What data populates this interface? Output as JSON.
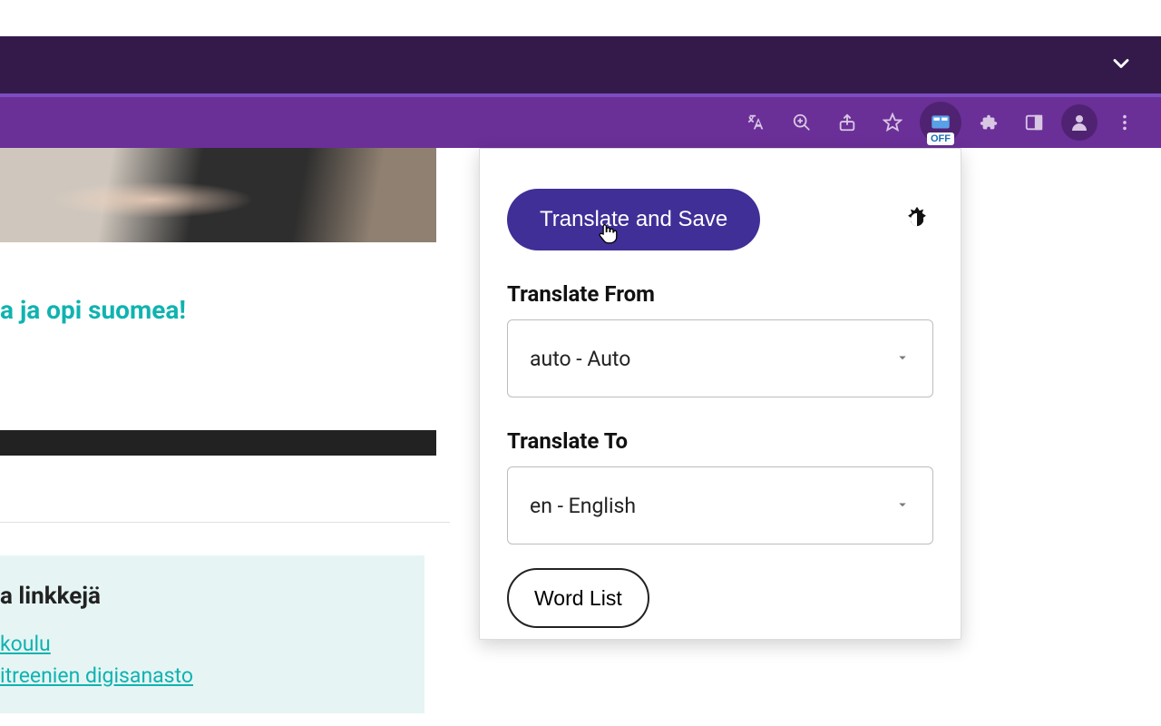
{
  "browser": {
    "extension_badge": "OFF"
  },
  "page": {
    "heading_fragment": "a ja opi suomea!",
    "sidebar_heading_fragment": "a linkkejä",
    "sidebar_links": [
      "koulu",
      "itreenien digisanasto"
    ]
  },
  "popup": {
    "main_button": "Translate and Save",
    "from_label": "Translate From",
    "from_value": "auto - Auto",
    "to_label": "Translate To",
    "to_value": "en - English",
    "wordlist_button": "Word List"
  }
}
